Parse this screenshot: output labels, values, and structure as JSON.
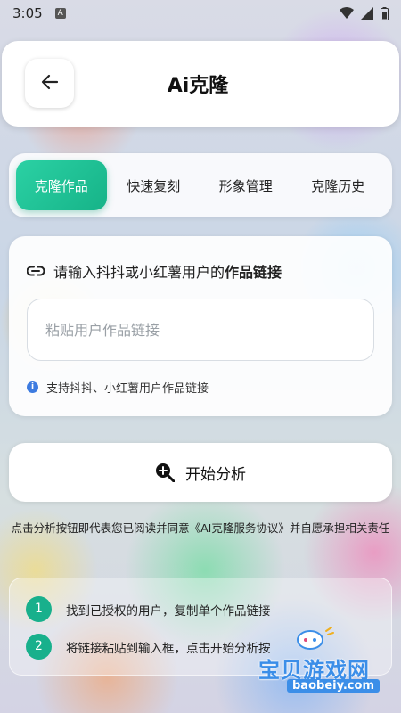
{
  "status_bar": {
    "time": "3:05",
    "notif_letter": "A"
  },
  "header": {
    "title": "Ai克隆"
  },
  "tabs": [
    {
      "label": "克隆作品",
      "active": true
    },
    {
      "label": "快速复刻",
      "active": false
    },
    {
      "label": "形象管理",
      "active": false
    },
    {
      "label": "克隆历史",
      "active": false
    }
  ],
  "input_card": {
    "label_prefix": "请输入抖抖或小红薯用户的",
    "label_emphasis": "作品链接",
    "placeholder": "粘贴用户作品链接",
    "hint": "支持抖抖、小红薯用户作品链接"
  },
  "analyze_button": {
    "label": "开始分析"
  },
  "agreement": "点击分析按钮即代表您已阅读并同意《AI克隆服务协议》并自愿承担相关责任",
  "steps": [
    {
      "num": "1",
      "text": "找到已授权的用户，复制单个作品链接"
    },
    {
      "num": "2",
      "text": "将链接粘贴到输入框，点击开始分析按"
    }
  ],
  "watermark": {
    "text": "宝贝游戏网",
    "url": "baobeiy.com"
  },
  "colors": {
    "accent": "#16b388",
    "info": "#3d7be0",
    "watermark": "#3b8ee8"
  }
}
